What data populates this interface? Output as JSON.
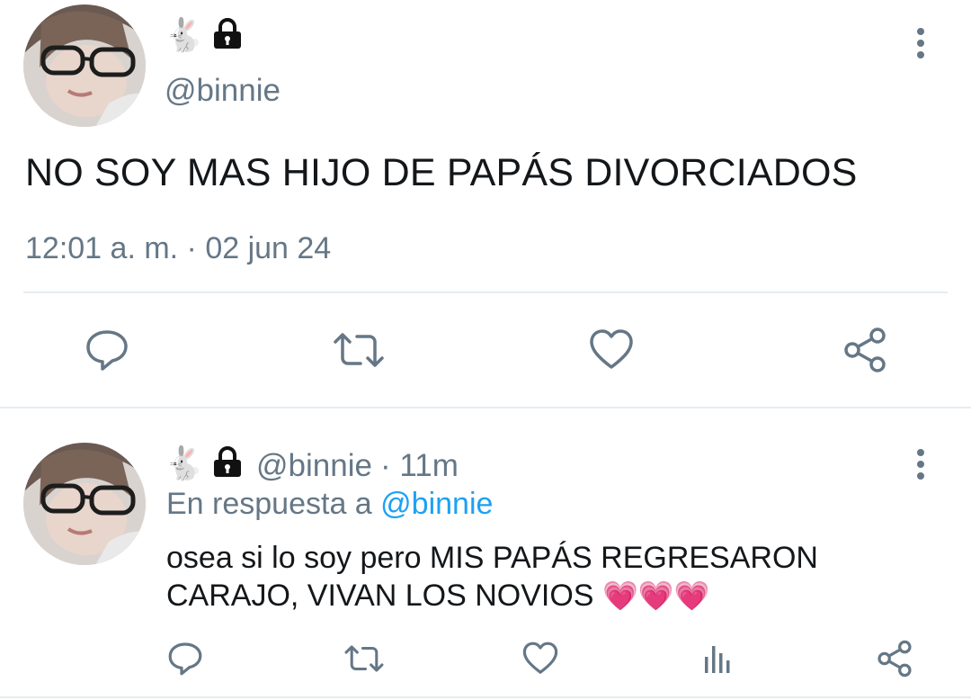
{
  "tweet_main": {
    "display_name_emoji": "🐇",
    "lock_icon": "lock-icon",
    "handle": "@binnie",
    "text": "NO SOY MAS HIJO DE PAPÁS DIVORCIADOS",
    "timestamp": "12:01 a. m. · 02 jun 24",
    "actions": [
      "reply-icon",
      "retweet-icon",
      "like-icon",
      "share-icon"
    ]
  },
  "tweet_reply": {
    "display_name_emoji": "🐇",
    "lock_icon": "lock-icon",
    "handle": "@binnie",
    "time": "· 11m",
    "reply_prefix": "En respuesta a",
    "reply_to": "@binnie",
    "text_line1": "osea si lo soy pero MIS PAPÁS REGRESARON",
    "text_line2": "CARAJO, VIVAN LOS NOVIOS",
    "hearts": "💗💗💗",
    "actions": [
      "reply-icon",
      "retweet-icon",
      "like-icon",
      "analytics-icon",
      "share-icon"
    ]
  },
  "colors": {
    "icon_gray": "#657786",
    "link_blue": "#1da1f2",
    "divider": "#e6ecf0"
  }
}
